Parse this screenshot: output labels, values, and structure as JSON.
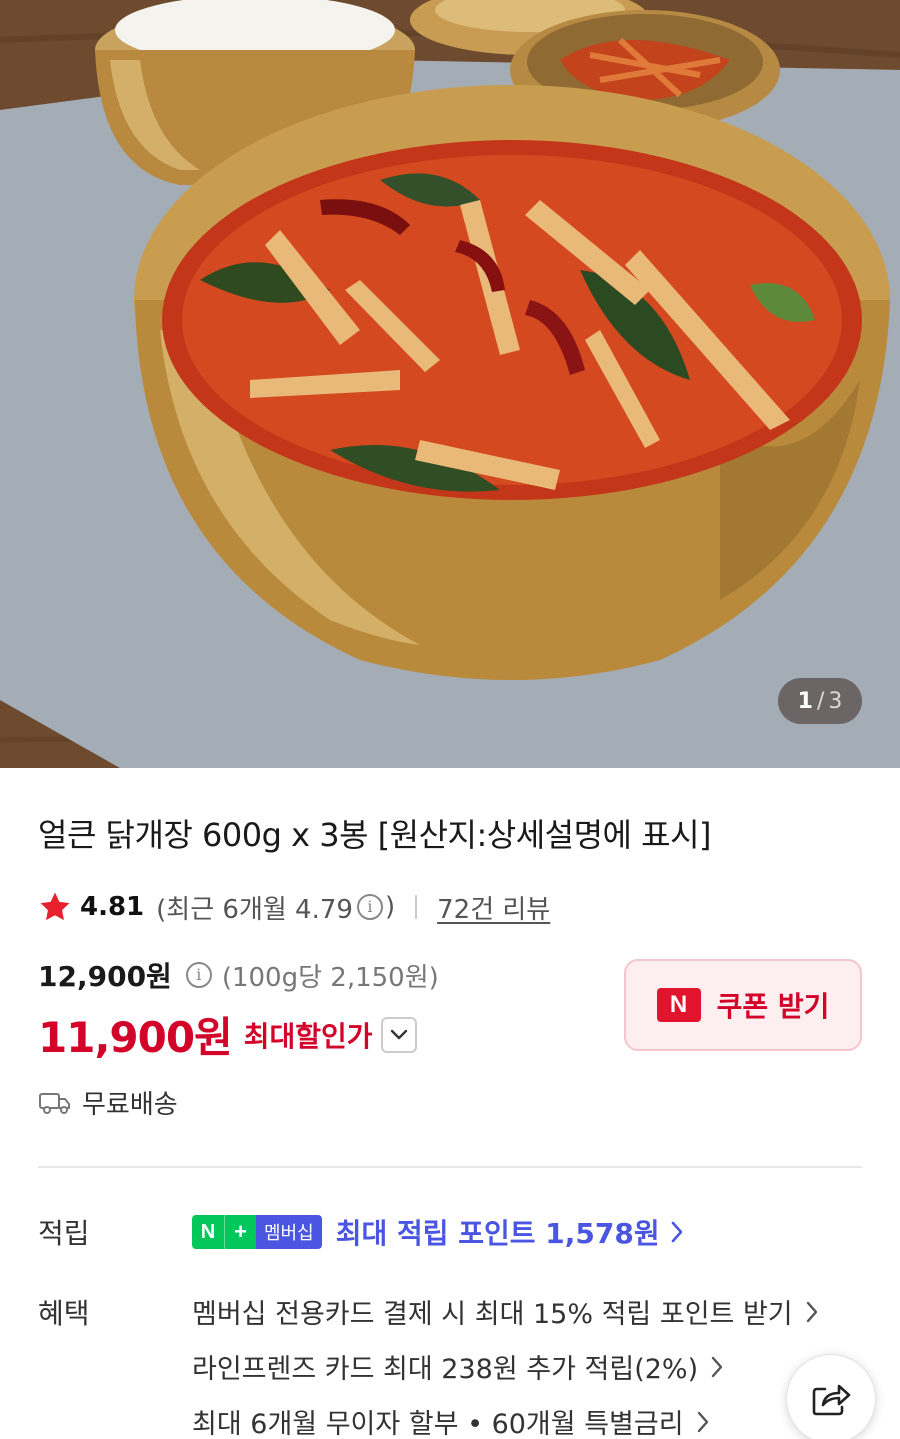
{
  "gallery": {
    "current": "1",
    "separator": "/",
    "total": "3",
    "image_alt": "product-photo-spicy-chicken-soup"
  },
  "product": {
    "title": "얼큰 닭개장 600g x 3봉 [원산지:상세설명에 표시]"
  },
  "rating": {
    "score": "4.81",
    "recent_prefix": "(최근 6개월 4.79",
    "recent_suffix": ")",
    "review_count": "72건 리뷰"
  },
  "price": {
    "original": "12,900원",
    "unit_price": "(100g당 2,150원)",
    "sale": "11,900원",
    "sale_label": "최대할인가"
  },
  "coupon": {
    "badge": "N",
    "label": "쿠폰 받기"
  },
  "shipping": {
    "label": "무료배송"
  },
  "points": {
    "label": "적립",
    "badge_n": "N",
    "badge_plus": "+",
    "badge_member": "멤버십",
    "text": "최대 적립 포인트 1,578원"
  },
  "benefits": {
    "label": "혜택",
    "items": [
      "멤버십 전용카드 결제 시 최대 15% 적립 포인트 받기",
      "라인프렌즈 카드 최대 238원 추가 적립(2%)",
      "최대 6개월 무이자 할부 • 60개월 특별금리"
    ]
  },
  "colors": {
    "sale_red": "#d3042a",
    "naver_green": "#03c75a",
    "membership_blue": "#4a56e2"
  },
  "icons": {
    "star": "star-icon",
    "info": "info-icon",
    "truck": "truck-icon",
    "share": "share-icon",
    "chevron_down": "chevron-down-icon",
    "chevron_right": "chevron-right-icon"
  }
}
